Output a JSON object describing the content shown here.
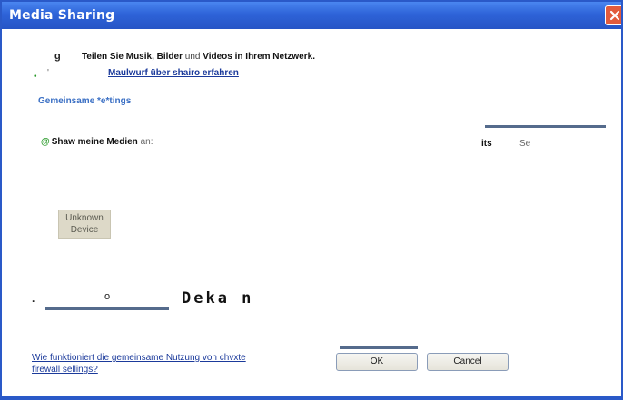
{
  "window": {
    "title": "Media Sharing",
    "close_icon": "close-icon"
  },
  "intro": {
    "glyph": "g",
    "part1": "Teilen Sie ",
    "bold1": "Musik, Bilder",
    "part2": " und ",
    "bold2": "Videos in Ihrem Netzwerk."
  },
  "learn": {
    "bullet": "•",
    "tick": "'",
    "link": "Maulwurf über shairo erfahren"
  },
  "settings": {
    "section_title": "Gemeinsame *e*tings",
    "at": "@",
    "share_label": "Shaw meine Medien",
    "share_suffix": " an:",
    "its": "its",
    "se": "Se"
  },
  "device": {
    "line1": "Unknown",
    "line2": "Device"
  },
  "slider": {
    "period": ".",
    "knob": "o",
    "text": "Deka n"
  },
  "footer": {
    "help_link": "Wie funktioniert die gemeinsame Nutzung von chvxte firewall sellings?",
    "ok": "OK",
    "cancel": "Cancel"
  },
  "colors": {
    "titlebar": "#2e63d8",
    "link": "#1b3a9b",
    "section": "#3a6fc4",
    "close": "#e25b3c"
  }
}
